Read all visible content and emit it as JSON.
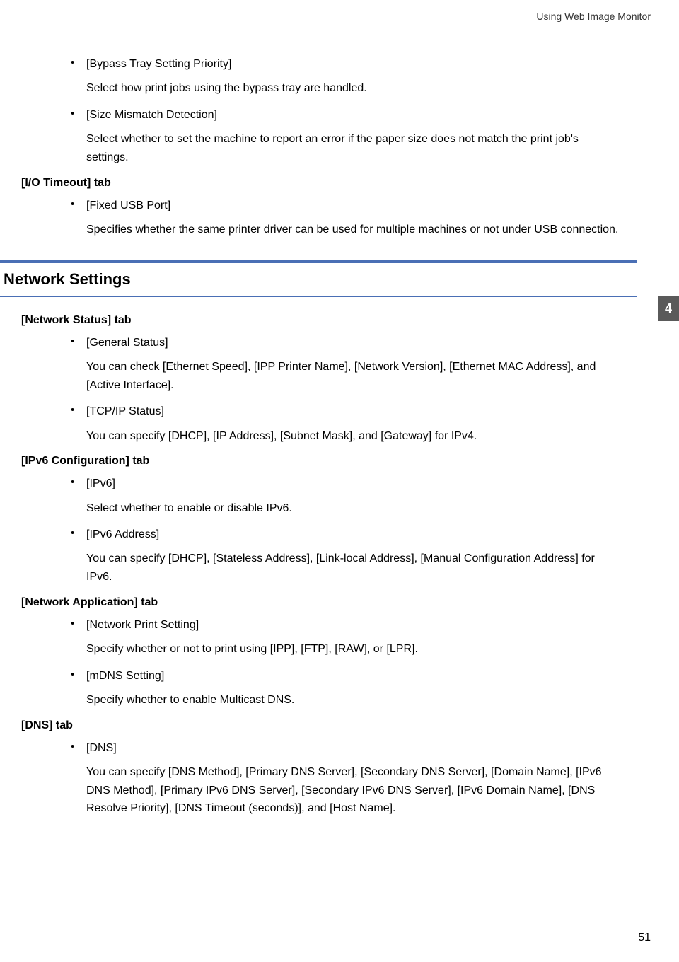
{
  "header": {
    "breadcrumb": "Using Web Image Monitor"
  },
  "chapter": "4",
  "pageNumber": "51",
  "top": {
    "item1": {
      "title": "[Bypass Tray Setting Priority]",
      "desc": "Select how print jobs using the bypass tray are handled."
    },
    "item2": {
      "title": "[Size Mismatch Detection]",
      "desc": "Select whether to set the machine to report an error if the paper size does not match the print job's settings."
    }
  },
  "ioTimeout": {
    "heading": "[I/O Timeout] tab",
    "item1": {
      "title": "[Fixed USB Port]",
      "desc": "Specifies whether the same printer driver can be used for multiple machines or not under USB connection."
    }
  },
  "networkSettings": {
    "heading": "Network Settings"
  },
  "networkStatus": {
    "heading": "[Network Status] tab",
    "item1": {
      "title": "[General Status]",
      "desc": "You can check [Ethernet Speed], [IPP Printer Name], [Network Version], [Ethernet MAC Address], and [Active Interface]."
    },
    "item2": {
      "title": "[TCP/IP Status]",
      "desc": "You can specify [DHCP], [IP Address], [Subnet Mask], and [Gateway] for IPv4."
    }
  },
  "ipv6Config": {
    "heading": "[IPv6 Configuration] tab",
    "item1": {
      "title": "[IPv6]",
      "desc": "Select whether to enable or disable IPv6."
    },
    "item2": {
      "title": "[IPv6 Address]",
      "desc": "You can specify [DHCP], [Stateless Address], [Link-local Address], [Manual Configuration Address] for IPv6."
    }
  },
  "networkApp": {
    "heading": "[Network Application] tab",
    "item1": {
      "title": "[Network Print Setting]",
      "desc": "Specify whether or not to print using [IPP], [FTP], [RAW], or [LPR]."
    },
    "item2": {
      "title": "[mDNS Setting]",
      "desc": "Specify whether to enable Multicast DNS."
    }
  },
  "dns": {
    "heading": "[DNS] tab",
    "item1": {
      "title": "[DNS]",
      "desc": "You can specify [DNS Method], [Primary DNS Server], [Secondary DNS Server], [Domain Name], [IPv6 DNS Method], [Primary IPv6 DNS Server], [Secondary IPv6 DNS Server], [IPv6 Domain Name], [DNS Resolve Priority], [DNS Timeout (seconds)], and [Host Name]."
    }
  }
}
